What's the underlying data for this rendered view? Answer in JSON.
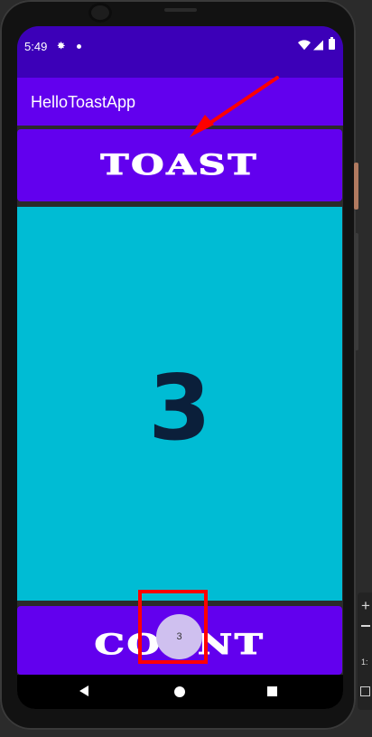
{
  "status_bar": {
    "time": "5:49",
    "icons": [
      "gear-icon",
      "dot-icon",
      "wifi-icon",
      "signal-icon",
      "battery-icon"
    ]
  },
  "app": {
    "title": "HelloToastApp"
  },
  "buttons": {
    "toast_label": "TOAST",
    "count_label": "COUNT"
  },
  "count": {
    "value": "3"
  },
  "toast_popup": {
    "text": "3"
  },
  "navigation": {
    "icons": [
      "back-icon",
      "home-icon",
      "recents-icon"
    ]
  },
  "emulator_toolbar": {
    "zoom_in": "+",
    "ratio": "1:"
  },
  "colors": {
    "status_bar": "#3c00b8",
    "primary": "#6200ee",
    "count_background": "#00bcd4",
    "count_text": "#0b1f3a",
    "annotation": "#ff0000"
  }
}
